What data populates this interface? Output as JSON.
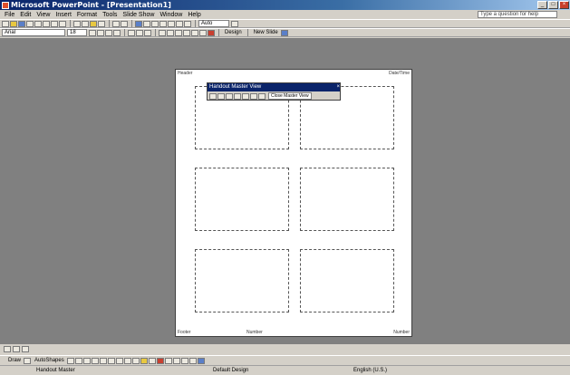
{
  "window": {
    "title": "Microsoft PowerPoint - [Presentation1]"
  },
  "menu": {
    "items": [
      "File",
      "Edit",
      "View",
      "Insert",
      "Format",
      "Tools",
      "Slide Show",
      "Window",
      "Help"
    ],
    "help_placeholder": "Type a question for help"
  },
  "toolbar": {
    "zoom": "Auto",
    "font": "Arial",
    "font_size": "18",
    "design_label": "Design",
    "new_slide_label": "New Slide"
  },
  "page": {
    "header_left": "Header",
    "header_right": "Date/Time",
    "footer_left": "Footer",
    "footer_center": "Number",
    "footer_right": "Number"
  },
  "float_toolbar": {
    "title": "Handout Master View",
    "close_button": "Close Master View"
  },
  "drawbar": {
    "draw_label": "Draw",
    "autoshapes_label": "AutoShapes"
  },
  "status": {
    "left": "Handout Master",
    "center": "Default Design",
    "right": "English (U.S.)"
  },
  "colors": {
    "titlebar": "#0a246a",
    "workspace": "#808080",
    "chrome": "#d4d0c8"
  }
}
